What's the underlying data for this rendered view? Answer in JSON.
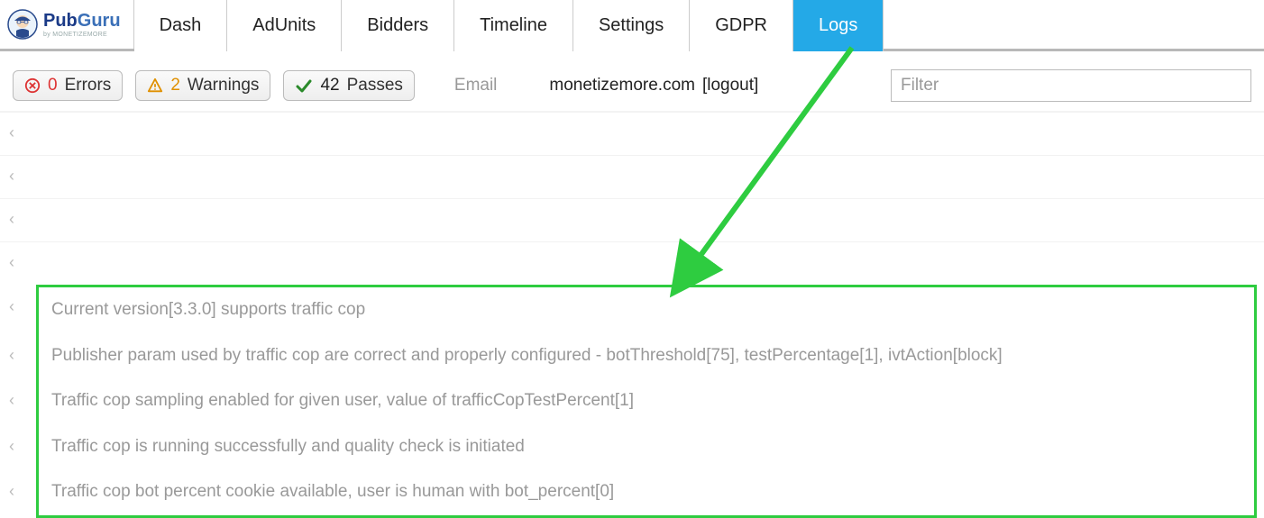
{
  "brand": {
    "name_a": "Pub",
    "name_b": "Guru",
    "byline": "by MONETIZEMORE"
  },
  "nav": {
    "items": [
      "Dash",
      "AdUnits",
      "Bidders",
      "Timeline",
      "Settings",
      "GDPR",
      "Logs"
    ],
    "active_index": 6
  },
  "status": {
    "errors": {
      "count": "0",
      "label": "Errors"
    },
    "warnings": {
      "count": "2",
      "label": "Warnings"
    },
    "passes": {
      "count": "42",
      "label": "Passes"
    }
  },
  "user": {
    "email_label": "Email",
    "domain": "monetizemore.com",
    "logout": "[logout]"
  },
  "filter": {
    "placeholder": "Filter"
  },
  "logs": {
    "blank_rows": 4,
    "highlighted": [
      "Current version[3.3.0] supports traffic cop",
      "Publisher param used by traffic cop are correct and properly configured - botThreshold[75], testPercentage[1], ivtAction[block]",
      "Traffic cop sampling enabled for given user, value of trafficCopTestPercent[1]",
      "Traffic cop is running successfully and quality check is initiated",
      "Traffic cop bot percent cookie available, user is human with bot_percent[0]"
    ]
  },
  "icons": {
    "caret": "‹"
  },
  "colors": {
    "accent": "#24a9e7",
    "highlight": "#2ecc40",
    "arrow": "#2ecc40"
  }
}
